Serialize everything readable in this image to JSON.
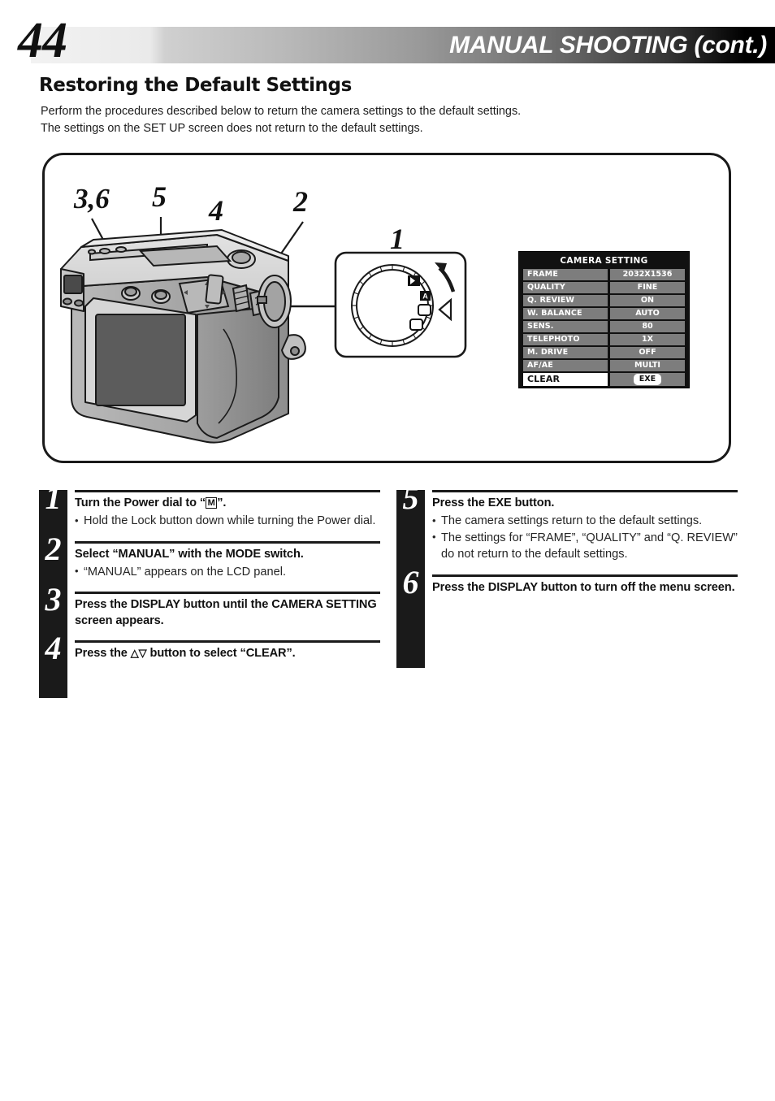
{
  "header": {
    "page_number": "44",
    "title": "MANUAL SHOOTING (cont.)"
  },
  "section": {
    "title": "Restoring the Default Settings",
    "intro_line1": "Perform the procedures described below to return the camera settings to the default settings.",
    "intro_line2": "The settings on the SET UP screen does not return to the default settings."
  },
  "diagram": {
    "callouts": [
      {
        "id": "callout-36",
        "label": "3,6"
      },
      {
        "id": "callout-5",
        "label": "5"
      },
      {
        "id": "callout-4",
        "label": "4"
      },
      {
        "id": "callout-2",
        "label": "2"
      },
      {
        "id": "callout-1",
        "label": "1"
      }
    ],
    "dial_icons": [
      "play-icon",
      "auto-icon",
      "manual-icon",
      "off-icon"
    ],
    "dial_pointer": "left-triangle-indicator",
    "dial_rotation_arrow": "counter-clockwise-arrow"
  },
  "osd": {
    "title": "CAMERA SETTING",
    "rows": [
      {
        "label": "FRAME",
        "value": "2032X1536"
      },
      {
        "label": "QUALITY",
        "value": "FINE"
      },
      {
        "label": "Q. REVIEW",
        "value": "ON"
      },
      {
        "label": "W. BALANCE",
        "value": "AUTO"
      },
      {
        "label": "SENS.",
        "value": "80"
      },
      {
        "label": "TELEPHOTO",
        "value": "1X"
      },
      {
        "label": "M. DRIVE",
        "value": "OFF"
      },
      {
        "label": "AF/AE",
        "value": "MULTI"
      }
    ],
    "selected_row": {
      "label": "CLEAR",
      "value": "EXE"
    },
    "colors": {
      "background": "#111111",
      "cell": "#7d7d7d",
      "highlight": "#ffffff"
    }
  },
  "steps": {
    "left": [
      {
        "number": "1",
        "head_before": "Turn the Power dial to “",
        "head_glyph": "M",
        "head_after": "”.",
        "bullets": [
          "Hold the Lock button down while turning the Power dial."
        ]
      },
      {
        "number": "2",
        "head_before": "Select “MANUAL” with the MODE switch.",
        "head_glyph": "",
        "head_after": "",
        "bullets": [
          "“MANUAL” appears on the LCD panel."
        ]
      },
      {
        "number": "3",
        "head_before": "Press the DISPLAY button until the CAMERA SETTING screen appears.",
        "head_glyph": "",
        "head_after": "",
        "bullets": []
      },
      {
        "number": "4",
        "head_before": "Press the ",
        "head_glyph": "△▽",
        "head_after": " button to select “CLEAR”.",
        "bullets": []
      }
    ],
    "right": [
      {
        "number": "5",
        "head_before": "Press the EXE button.",
        "head_glyph": "",
        "head_after": "",
        "bullets": [
          "The camera settings return to the default settings.",
          "The settings for “FRAME”, “QUALITY” and “Q. REVIEW” do not return to the default settings."
        ]
      },
      {
        "number": "6",
        "head_before": "Press the DISPLAY button to turn off the menu screen.",
        "head_glyph": "",
        "head_after": "",
        "bullets": []
      }
    ]
  }
}
